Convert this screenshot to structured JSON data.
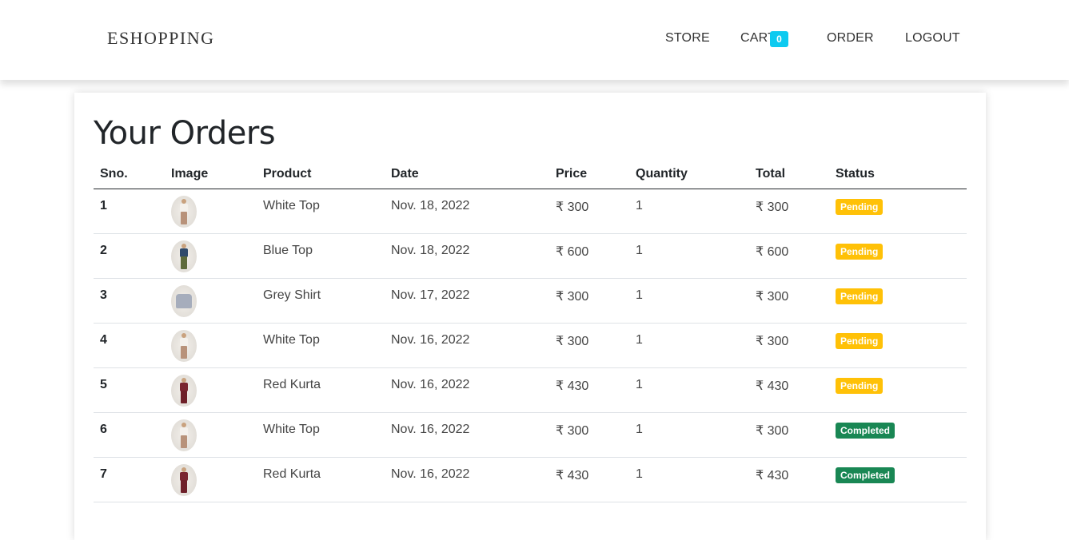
{
  "nav": {
    "brand": "ESHOPPING",
    "store": "STORE",
    "cart": "CART",
    "cart_count": "0",
    "order": "ORDER",
    "logout": "LOGOUT"
  },
  "page": {
    "title": "Your Orders"
  },
  "table": {
    "headers": [
      "Sno.",
      "Image",
      "Product",
      "Date",
      "Price",
      "Quantity",
      "Total",
      "Status"
    ],
    "rows": [
      {
        "sno": "1",
        "image": "white-top-image",
        "product": "White Top",
        "date": "Nov. 18, 2022",
        "price": "₹ 300",
        "quantity": "1",
        "total": "₹ 300",
        "status": "Pending"
      },
      {
        "sno": "2",
        "image": "blue-top-image",
        "product": "Blue Top",
        "date": "Nov. 18, 2022",
        "price": "₹ 600",
        "quantity": "1",
        "total": "₹ 600",
        "status": "Pending"
      },
      {
        "sno": "3",
        "image": "grey-shirt-image",
        "product": "Grey Shirt",
        "date": "Nov. 17, 2022",
        "price": "₹ 300",
        "quantity": "1",
        "total": "₹ 300",
        "status": "Pending"
      },
      {
        "sno": "4",
        "image": "white-top-image",
        "product": "White Top",
        "date": "Nov. 16, 2022",
        "price": "₹ 300",
        "quantity": "1",
        "total": "₹ 300",
        "status": "Pending"
      },
      {
        "sno": "5",
        "image": "red-kurta-image",
        "product": "Red Kurta",
        "date": "Nov. 16, 2022",
        "price": "₹ 430",
        "quantity": "1",
        "total": "₹ 430",
        "status": "Pending"
      },
      {
        "sno": "6",
        "image": "white-top-image",
        "product": "White Top",
        "date": "Nov. 16, 2022",
        "price": "₹ 300",
        "quantity": "1",
        "total": "₹ 300",
        "status": "Completed"
      },
      {
        "sno": "7",
        "image": "red-kurta-image",
        "product": "Red Kurta",
        "date": "Nov. 16, 2022",
        "price": "₹ 430",
        "quantity": "1",
        "total": "₹ 430",
        "status": "Completed"
      }
    ]
  },
  "colors": {
    "cart_badge": "#0dcaf0",
    "status_pending": "#ffc107",
    "status_completed": "#198754"
  }
}
